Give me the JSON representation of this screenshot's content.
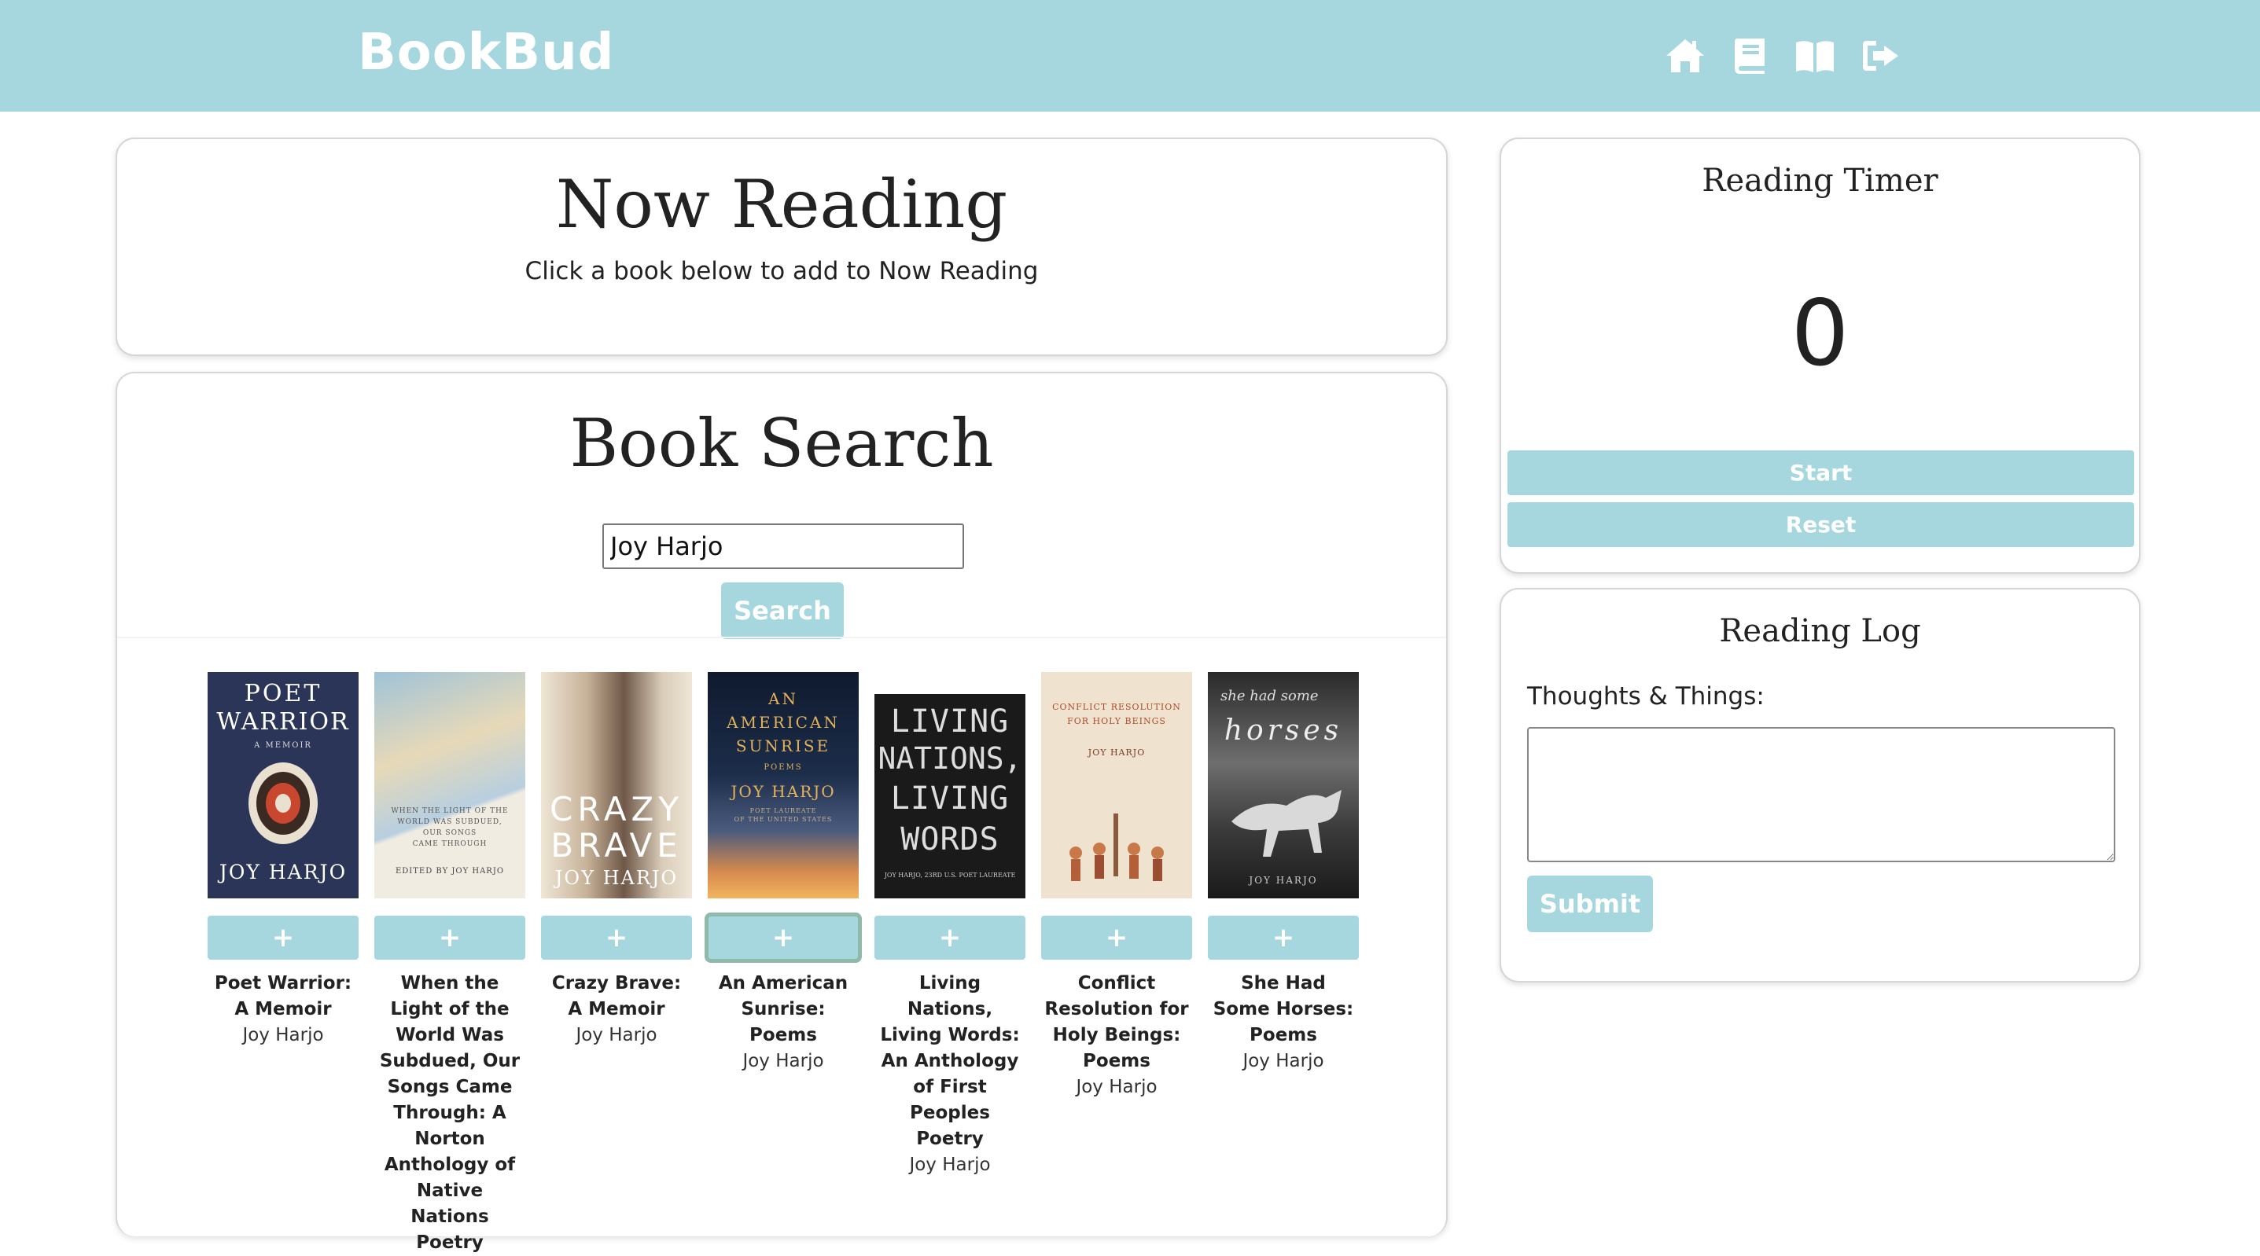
{
  "app": {
    "brand": "BookBud"
  },
  "nav": {
    "icons": [
      "home-icon",
      "book-icon",
      "open-book-icon",
      "sign-out-icon"
    ]
  },
  "now_reading": {
    "title": "Now Reading",
    "hint": "Click a book below to add to Now Reading"
  },
  "search": {
    "title": "Book Search",
    "query": "Joy Harjo",
    "button": "Search"
  },
  "books": [
    {
      "title": "Poet Warrior: A Memoir",
      "author": "Joy Harjo",
      "add": "+",
      "cover_text": [
        "POET",
        "WARRIOR",
        "A MEMOIR",
        "JOY HARJO"
      ]
    },
    {
      "title": "When the Light of the World Was Subdued, Our Songs Came Through: A Norton Anthology of Native Nations Poetry",
      "author": "",
      "add": "+",
      "cover_text": [
        "WHEN THE LIGHT OF THE",
        "WORLD WAS SUBDUED,",
        "OUR SONGS",
        "CAME THROUGH",
        "EDITED BY JOY HARJO"
      ]
    },
    {
      "title": "Crazy Brave: A Memoir",
      "author": "Joy Harjo",
      "add": "+",
      "cover_text": [
        "CRAZY",
        "BRAVE",
        "JOY HARJO"
      ]
    },
    {
      "title": "An American Sunrise: Poems",
      "author": "Joy Harjo",
      "add": "+",
      "cover_text": [
        "AN",
        "AMERICAN",
        "SUNRISE",
        "POEMS",
        "JOY HARJO",
        "POET LAUREATE",
        "OF THE UNITED STATES"
      ]
    },
    {
      "title": "Living Nations, Living Words: An Anthology of First Peoples Poetry",
      "author": "Joy Harjo",
      "add": "+",
      "cover_text": [
        "LIVING",
        "NATIONS,",
        "LIVING",
        "WORDS",
        "JOY HARJO, 23RD U.S. POET LAUREATE"
      ]
    },
    {
      "title": "Conflict Resolution for Holy Beings: Poems",
      "author": "Joy Harjo",
      "add": "+",
      "cover_text": [
        "CONFLICT RESOLUTION",
        "FOR HOLY BEINGS",
        "JOY HARJO"
      ]
    },
    {
      "title": "She Had Some Horses: Poems",
      "author": "Joy Harjo",
      "add": "+",
      "cover_text": [
        "she had some",
        "horses",
        "JOY HARJO"
      ]
    }
  ],
  "timer": {
    "title": "Reading Timer",
    "value": "0",
    "start": "Start",
    "reset": "Reset"
  },
  "log": {
    "title": "Reading Log",
    "label": "Thoughts & Things:",
    "value": "",
    "submit": "Submit"
  },
  "colors": {
    "accent": "#a6d7df",
    "focus_ring": "#8fb9a8"
  }
}
